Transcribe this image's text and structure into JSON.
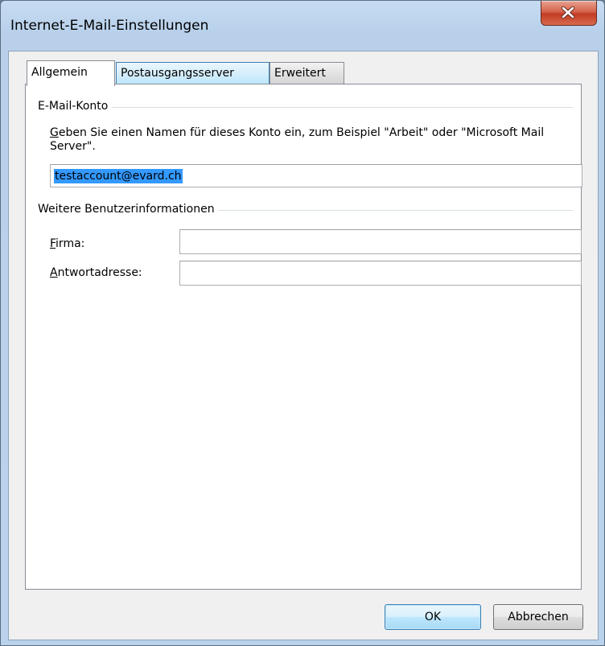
{
  "window": {
    "title": "Internet-E-Mail-Einstellungen"
  },
  "tabs": [
    {
      "label": "Allgemein",
      "selected": true
    },
    {
      "label": "Postausgangsserver",
      "selected": false
    },
    {
      "label": "Erweitert",
      "selected": false
    }
  ],
  "email_account": {
    "group_title": "E-Mail-Konto",
    "description_first": "G",
    "description_rest": "eben Sie einen Namen für dieses Konto ein, zum Beispiel \"Arbeit\" oder \"Microsoft Mail Server\".",
    "account_name_value": "testaccount@evard.ch"
  },
  "user_info": {
    "group_title": "Weitere Benutzerinformationen",
    "company_label_first": "F",
    "company_label_rest": "irma:",
    "company_value": "",
    "reply_label_first": "A",
    "reply_label_rest": "ntwortadresse:",
    "reply_value": ""
  },
  "buttons": {
    "ok": "OK",
    "cancel": "Abbrechen"
  },
  "colors": {
    "selection": "#3399ff",
    "close_button": "#c23b22",
    "titlebar": "#c6dcf2"
  }
}
